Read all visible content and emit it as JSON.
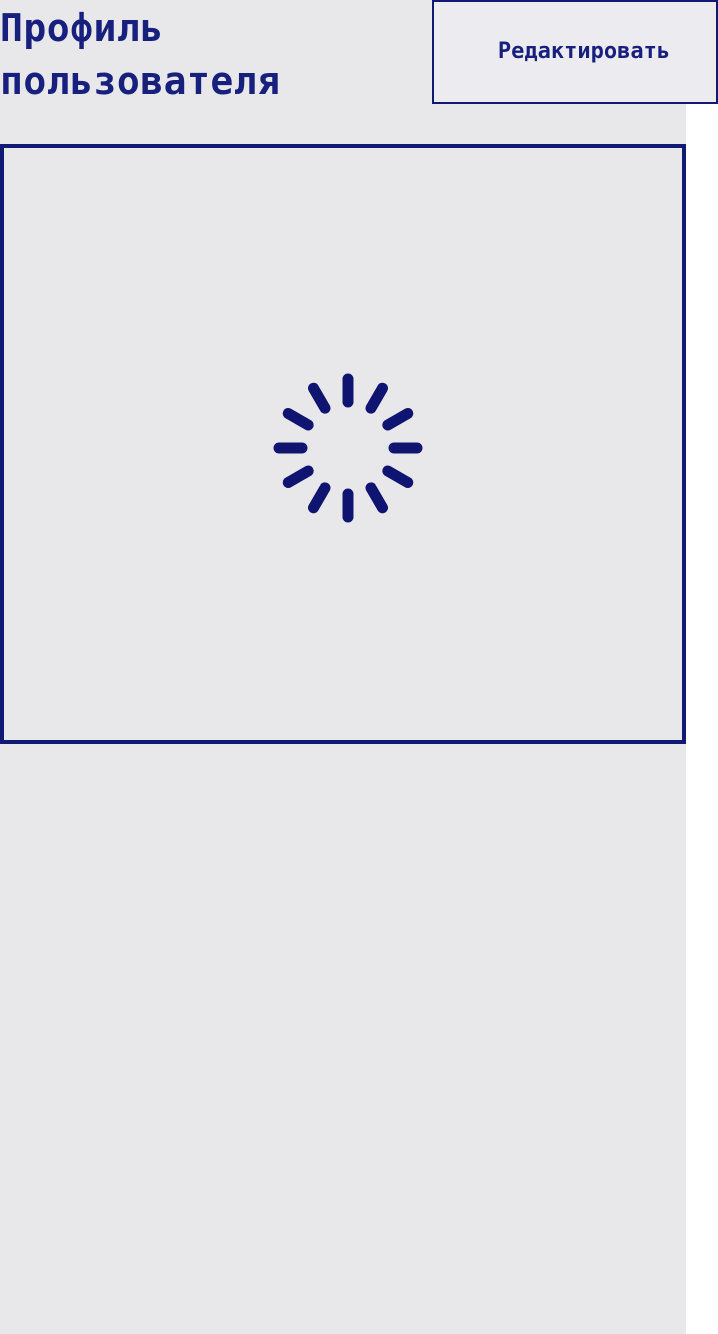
{
  "header": {
    "title": "Профиль\nпользователя",
    "edit_button_label": "Редактировать"
  },
  "profile_panel": {
    "state": "loading",
    "spinner_color": "#0f1470",
    "border_color": "#101a72",
    "background_color": "#e8e8eb"
  }
}
